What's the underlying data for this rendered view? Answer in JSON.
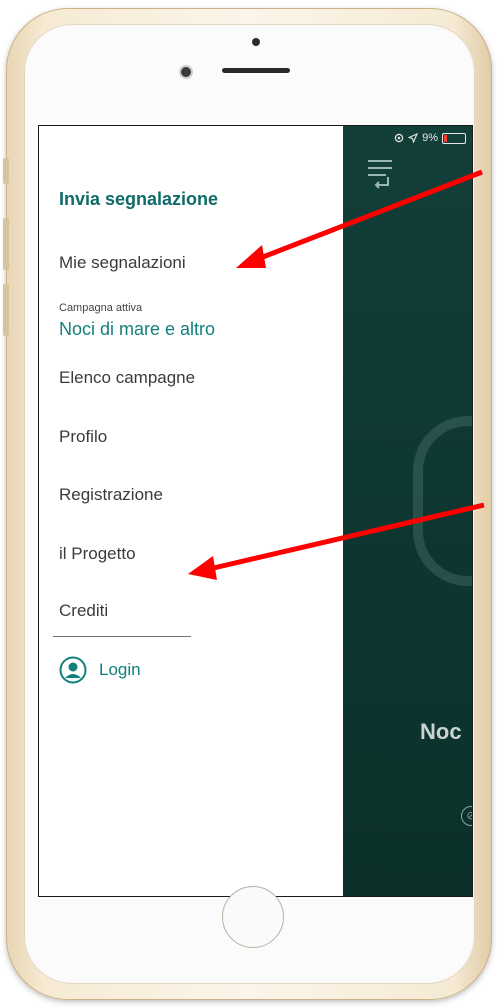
{
  "status_bar": {
    "battery_text": "9%"
  },
  "drawer": {
    "primary_item": "Invia segnalazione",
    "my_reports": "Mie segnalazioni",
    "active_campaign_label": "Campagna attiva",
    "active_campaign_value": "Noci di mare e altro",
    "campaign_list": "Elenco campagne",
    "profile": "Profilo",
    "registration": "Registrazione",
    "project": "il Progetto",
    "credits": "Crediti",
    "login": "Login"
  },
  "background_app": {
    "title_fragment": "Noc"
  },
  "colors": {
    "accent": "#0e6b68",
    "arrow": "#ff0000",
    "app_bg": "#0f3a33"
  },
  "icons": [
    "hamburger-menu-icon",
    "user-circle-icon",
    "location-arrow-icon",
    "battery-icon"
  ]
}
